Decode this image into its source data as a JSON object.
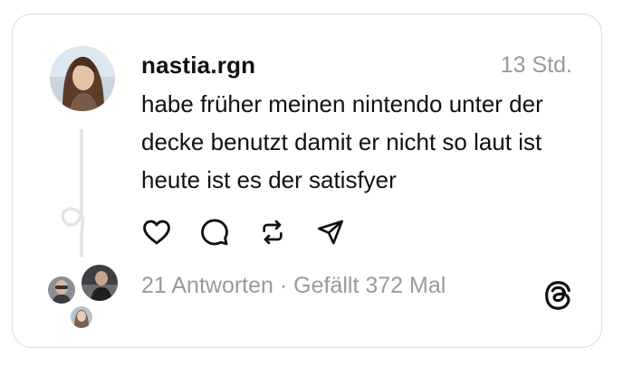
{
  "post": {
    "username": "nastia.rgn",
    "timestamp": "13 Std.",
    "text": "habe früher meinen nintendo unter der decke benutzt damit er nicht so laut ist heute ist es der satisfyer"
  },
  "actions": {
    "like_icon": "heart-icon",
    "reply_icon": "comment-icon",
    "repost_icon": "repost-icon",
    "share_icon": "send-icon"
  },
  "stats": {
    "replies": "21 Antworten",
    "separator": " · ",
    "likes": "Gefällt 372 Mal"
  },
  "colors": {
    "text": "#111111",
    "muted": "#9a9a9a",
    "border": "#dcdcdc",
    "thread_line": "#e3e3e3"
  }
}
